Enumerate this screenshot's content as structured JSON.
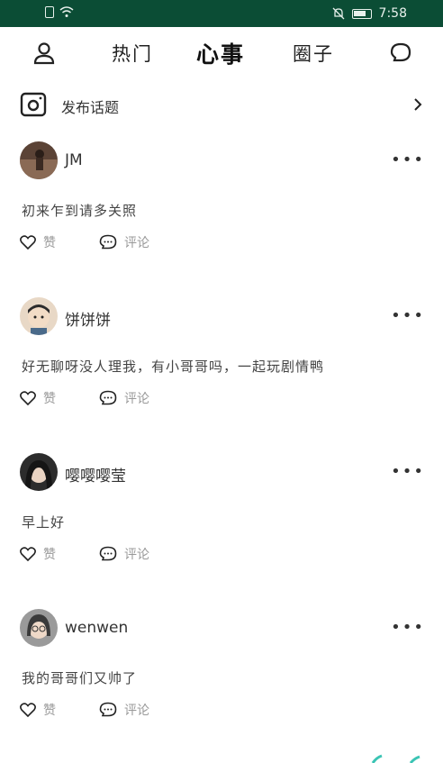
{
  "status_bar": {
    "time": "7:58",
    "icons": [
      "sim-icon",
      "wifi-icon",
      "mute-icon",
      "battery-icon"
    ]
  },
  "nav": {
    "profile_icon": "person-icon",
    "tabs": [
      {
        "label": "热门"
      },
      {
        "label": "心事"
      },
      {
        "label": "圈子"
      }
    ],
    "chat_icon": "chat-bubble-icon"
  },
  "topic": {
    "icon": "camera-icon",
    "label": "发布话题",
    "chevron": "chevron-right-icon"
  },
  "posts": [
    {
      "username": "JM",
      "content": "初来乍到请多关照",
      "like_label": "赞",
      "comment_label": "评论",
      "avatar_color": "#7a5a4a"
    },
    {
      "username": "饼饼饼",
      "content": "好无聊呀没人理我，有小哥哥吗，一起玩剧情鸭",
      "like_label": "赞",
      "comment_label": "评论",
      "avatar_color": "#d9c2a8"
    },
    {
      "username": "嘤嘤嘤莹",
      "content": "早上好",
      "like_label": "赞",
      "comment_label": "评论",
      "avatar_color": "#3a3a3a"
    },
    {
      "username": "wenwen",
      "content": "我的哥哥们又帅了",
      "like_label": "赞",
      "comment_label": "评论",
      "avatar_color": "#8a8a8a"
    }
  ],
  "more_label": "•••",
  "colors": {
    "status_bar": "#0b4d35",
    "text_primary": "#222222",
    "text_muted": "#999999"
  }
}
